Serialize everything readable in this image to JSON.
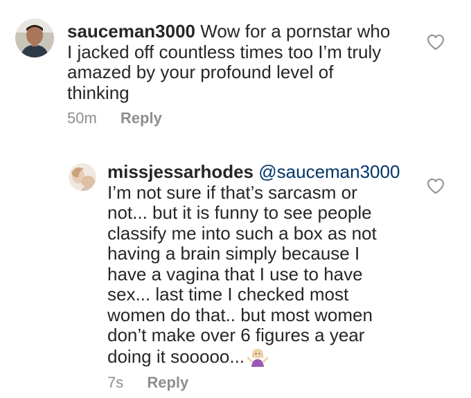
{
  "comments": [
    {
      "username": "sauceman3000",
      "text_lines": [
        " Wow for a pornstar who",
        "I jacked off countless times too I’m truly",
        "amazed by your profound level of",
        "thinking"
      ],
      "time": "50m",
      "reply_label": "Reply",
      "avatar_icon": "profile-photo-man",
      "like_icon": "heart-outline-icon"
    },
    {
      "username": "missjessarhodes",
      "mention": "@sauceman3000",
      "text_lines": [
        "I’m not sure if that’s sarcasm or",
        "not... but it is funny to see people",
        "classify me into such a box as not",
        "having a brain simply because I",
        "have a vagina that I use to have",
        "sex... last time I checked most",
        "women do that.. but most women",
        "don’t make over 6 figures a year",
        "doing it sooooo..."
      ],
      "emoji": "person-shrugging-emoji",
      "time": "7s",
      "reply_label": "Reply",
      "avatar_icon": "profile-photo-woman",
      "like_icon": "heart-outline-icon"
    }
  ],
  "colors": {
    "text": "#262626",
    "secondary": "#8e8e8e",
    "mention": "#003569"
  }
}
